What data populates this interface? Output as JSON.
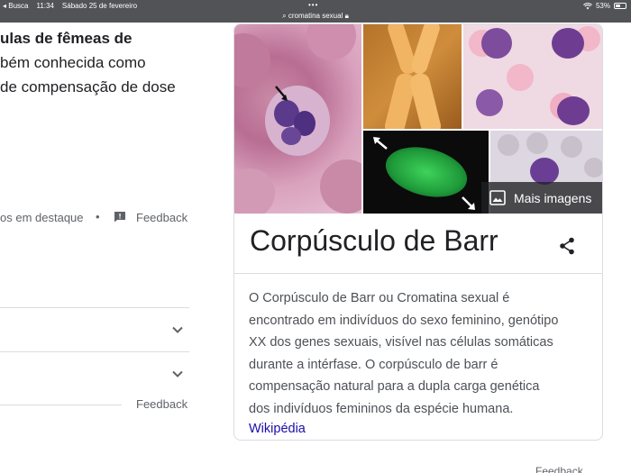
{
  "status_bar": {
    "back_app": "◂ Busca",
    "time": "11:34",
    "date": "Sábado 25 de fevereiro",
    "url": "cromatina sexual",
    "battery": "53%",
    "battery_level": 0.53
  },
  "left_column": {
    "snippet_lines": [
      "ulas de fêmeas de",
      "bém conhecida como",
      "de compensação de dose"
    ],
    "meta_label": "os em destaque",
    "bullet": "•",
    "feedback_label": "Feedback",
    "feedback_label_2": "Feedback"
  },
  "knowledge_panel": {
    "more_images_label": "Mais imagens",
    "title": "Corpúsculo de Barr",
    "description_lines": [
      "O Corpúsculo de Barr ou Cromatina sexual é",
      "encontrado em indivíduos do sexo feminino, genótipo",
      "XX dos genes sexuais, visível nas células somáticas",
      "durante a intérfase. O corpúsculo de barr é",
      "compensação natural para a dupla carga genética",
      "dos indivíduos femininos da espécie humana."
    ],
    "source_link": "Wikipédia"
  },
  "bottom_cut_text": "Feedback",
  "colors": {
    "status_bar_bg": "#525357",
    "link": "#1a0dab",
    "text_secondary": "#5f6368",
    "border": "#dadce0"
  }
}
